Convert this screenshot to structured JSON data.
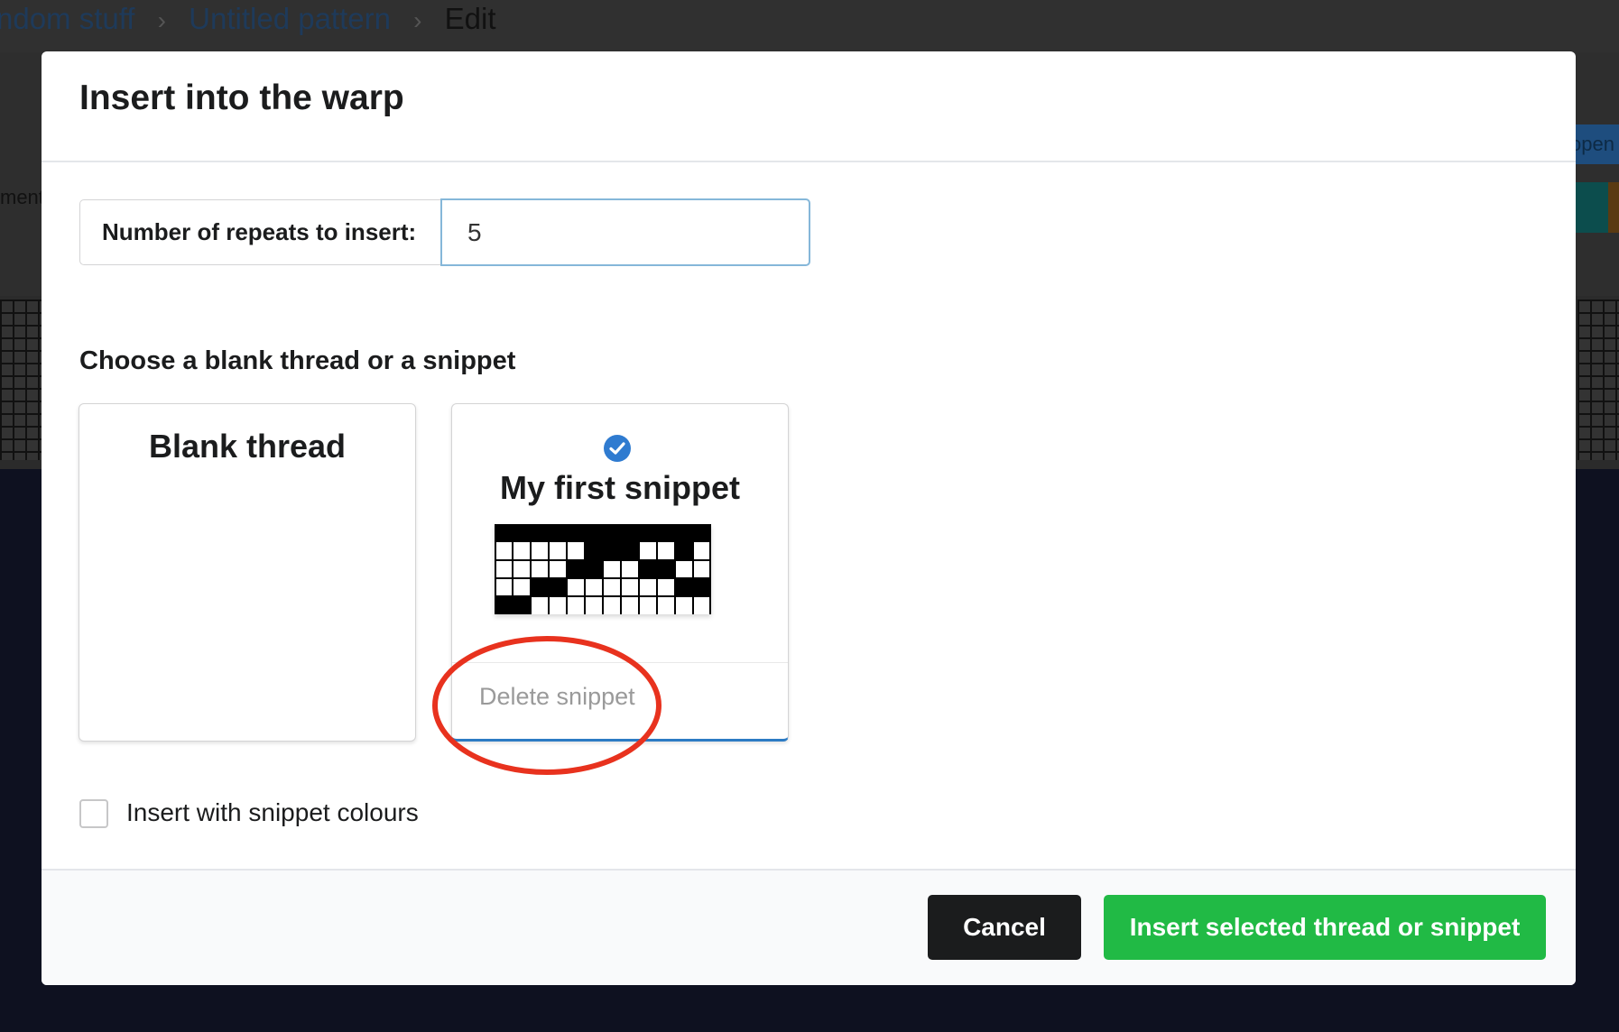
{
  "background": {
    "breadcrumbs": [
      {
        "label": "ndom stuff"
      },
      {
        "label": "Untitled pattern"
      },
      {
        "label": "Edit"
      }
    ],
    "side_text": "ment",
    "right_tab_text": "open"
  },
  "modal": {
    "title": "Insert into the warp",
    "repeats": {
      "label": "Number of repeats to insert:",
      "value": "5"
    },
    "section_title": "Choose a blank thread or a snippet",
    "cards": {
      "blank": {
        "title": "Blank thread",
        "selected": false
      },
      "snippet": {
        "title": "My first snippet",
        "selected": true,
        "delete_label": "Delete snippet"
      }
    },
    "snippet_colours": {
      "label": "Insert with snippet colours",
      "checked": false
    },
    "buttons": {
      "cancel": "Cancel",
      "insert": "Insert selected thread or snippet"
    }
  },
  "colors": {
    "primary_green": "#21ba45",
    "cancel_dark": "#1b1c1d",
    "check_blue": "#2f7bd0",
    "annotation_red": "#e8321e"
  },
  "icons": {
    "selected": "check-circle-icon",
    "chevron": "chevron-right-icon"
  }
}
